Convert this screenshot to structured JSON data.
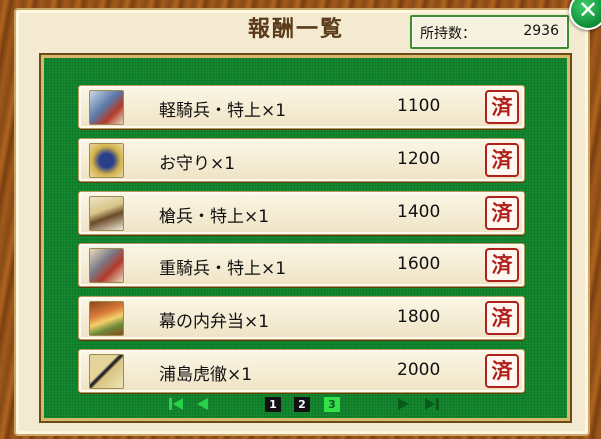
{
  "title": "報酬一覧",
  "holdings": {
    "label": "所持数：",
    "value": "2936"
  },
  "close_symbol": "✕",
  "rewards": [
    {
      "name": "軽騎兵・特上×1",
      "cost": "1100",
      "status": "済",
      "icon": "light-cavalry-icon"
    },
    {
      "name": "お守り×1",
      "cost": "1200",
      "status": "済",
      "icon": "amulet-icon"
    },
    {
      "name": "槍兵・特上×1",
      "cost": "1400",
      "status": "済",
      "icon": "spearman-icon"
    },
    {
      "name": "重騎兵・特上×1",
      "cost": "1600",
      "status": "済",
      "icon": "heavy-cavalry-icon"
    },
    {
      "name": "幕の内弁当×1",
      "cost": "1800",
      "status": "済",
      "icon": "bento-icon"
    },
    {
      "name": "浦島虎徹×1",
      "cost": "2000",
      "status": "済",
      "icon": "katana-icon"
    }
  ],
  "pager": {
    "pages": [
      "1",
      "2",
      "3"
    ],
    "current": "3"
  },
  "colors": {
    "board": "#138a2f",
    "stamp": "#b0201c",
    "active_page": "#34e04a"
  }
}
